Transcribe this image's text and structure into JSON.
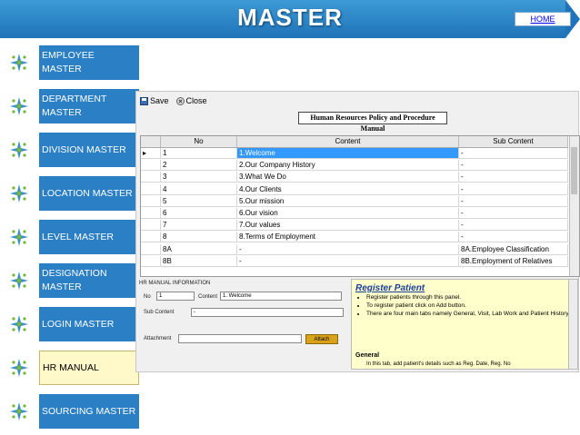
{
  "header": {
    "title": "MASTER",
    "home_label": "HOME"
  },
  "sidebar": {
    "items": [
      {
        "label": "EMPLOYEE MASTER",
        "active": false
      },
      {
        "label": "DEPARTMENT MASTER",
        "active": false
      },
      {
        "label": "DIVISION MASTER",
        "active": false
      },
      {
        "label": "LOCATION MASTER",
        "active": false
      },
      {
        "label": "LEVEL MASTER",
        "active": false
      },
      {
        "label": "DESIGNATION MASTER",
        "active": false
      },
      {
        "label": "LOGIN MASTER",
        "active": false
      },
      {
        "label": "HR MANUAL",
        "active": true
      },
      {
        "label": "SOURCING MASTER",
        "active": false
      }
    ]
  },
  "toolbar": {
    "save_label": "Save",
    "close_label": "Close"
  },
  "manual": {
    "title": "Human Resources Policy and Procedure Manual"
  },
  "grid": {
    "columns": [
      "No",
      "Content",
      "Sub Content"
    ],
    "rows": [
      {
        "no": "1",
        "content": "1.Welcome",
        "sub": "-"
      },
      {
        "no": "2",
        "content": "2.Our Company History",
        "sub": "-"
      },
      {
        "no": "3",
        "content": "3.What We Do",
        "sub": "-"
      },
      {
        "no": "4",
        "content": " 4.Our Clients",
        "sub": "-"
      },
      {
        "no": "5",
        "content": "5.Our mission",
        "sub": "-"
      },
      {
        "no": "6",
        "content": "6.Our vision",
        "sub": "-"
      },
      {
        "no": "7",
        "content": "7.Our values",
        "sub": "-"
      },
      {
        "no": "8",
        "content": "8.Terms of Employment",
        "sub": "-"
      },
      {
        "no": "8A",
        "content": "-",
        "sub": "8A.Employee Classification"
      },
      {
        "no": "8B",
        "content": "-",
        "sub": "8B.Employment of Relatives"
      }
    ]
  },
  "form": {
    "section_label": "HR MANUAL INFORMATION",
    "no_label": "No",
    "no_value": "1",
    "content_label": "Content",
    "content_value": "1.        Welcome",
    "sub_content_label": "Sub Content",
    "sub_content_value": "-",
    "attachment_label": "Attachment",
    "attach_button": "Attach"
  },
  "help": {
    "title": "Register Patient",
    "bullets": [
      "Register patients through this panel.",
      "To register patient click on Add button.",
      "There are four main tabs namely General, Visit, Lab Work and Patient History."
    ],
    "general_heading": "General",
    "general_text": "In this tab, add patient's details such as Reg. Date, Reg. No"
  },
  "colors": {
    "banner": "#1f73b8",
    "nav": "#2a7fc5",
    "nav_active": "#fff8c8",
    "selected_cell": "#3399ff"
  }
}
